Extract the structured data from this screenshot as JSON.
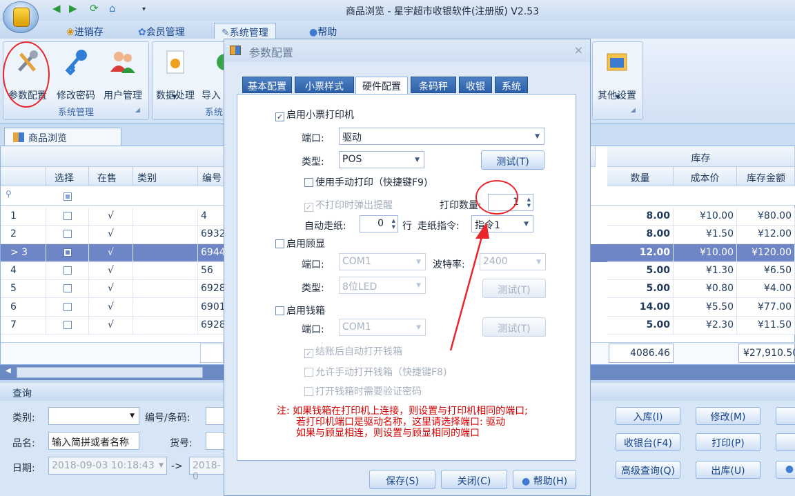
{
  "window": {
    "title": "商品浏览 - 星宇超市收银软件(注册版) V2.53",
    "quick_access": [
      "◀",
      "▶",
      "⟳",
      "⌂",
      "▾"
    ]
  },
  "ribbon_tabs": [
    "进销存",
    "会员管理",
    "系统管理",
    "帮助"
  ],
  "ribbon": {
    "group1": {
      "label": "系统管理",
      "buttons": [
        "参数配置",
        "修改密码",
        "用户管理"
      ]
    },
    "group2": {
      "label": "系统",
      "buttons": [
        "数据处理",
        "导入"
      ]
    },
    "group3": {
      "label": "",
      "buttons": [
        "其他设置"
      ]
    }
  },
  "doc_tab": "商品浏览",
  "grid": {
    "headers": {
      "select": "选择",
      "on_sale": "在售",
      "category": "类别",
      "code": "编号",
      "stock_group": "库存",
      "qty": "数量",
      "cost": "成本价",
      "amount": "库存金额"
    },
    "rows": [
      {
        "no": "1",
        "code": "4",
        "qty": "8.00",
        "cost": "¥10.00",
        "amount": "¥80.00",
        "mark": "√"
      },
      {
        "no": "2",
        "code": "6932",
        "qty": "8.00",
        "cost": "¥1.50",
        "amount": "¥12.00",
        "mark": "√"
      },
      {
        "no": "3",
        "code": "6944",
        "qty": "12.00",
        "cost": "¥10.00",
        "amount": "¥120.00",
        "mark": "√",
        "current": ">"
      },
      {
        "no": "4",
        "code": "56",
        "qty": "5.00",
        "cost": "¥1.30",
        "amount": "¥6.50",
        "mark": "√"
      },
      {
        "no": "5",
        "code": "6928",
        "qty": "5.00",
        "cost": "¥0.80",
        "amount": "¥4.00",
        "mark": "√"
      },
      {
        "no": "6",
        "code": "6901",
        "qty": "14.00",
        "cost": "¥5.50",
        "amount": "¥77.00",
        "mark": "√"
      },
      {
        "no": "7",
        "code": "6928",
        "qty": "5.00",
        "cost": "¥2.30",
        "amount": "¥11.50",
        "mark": "√"
      }
    ],
    "totals": {
      "qty": "4086.46",
      "amount": "¥27,910.50"
    }
  },
  "query": {
    "title": "查询",
    "category_label": "类别:",
    "code_label": "编号/条码:",
    "name_label": "品名:",
    "name_placeholder": "输入简拼或者名称",
    "item_no_label": "货号:",
    "date_label": "日期:",
    "date_from": "2018-09-03 10:18:43",
    "date_to": "2018-0",
    "arrow": "->",
    "buttons": [
      "入库(I)",
      "修改(M)",
      "收银台(F4)",
      "打印(P)",
      "高级查询(Q)",
      "出库(U)"
    ]
  },
  "dialog": {
    "title": "参数配置",
    "close": "×",
    "tabs": [
      "基本配置",
      "小票样式",
      "硬件配置",
      "条码秤",
      "收银",
      "系统"
    ],
    "printer": {
      "enable_label": "启用小票打印机",
      "port_label": "端口:",
      "port_value": "驱动",
      "type_label": "类型:",
      "type_value": "POS",
      "test_button": "测试(T)",
      "manual_label": "使用手动打印（快捷键F9)",
      "no_print_remind_label": "不打印时弹出提醒",
      "copies_label": "打印数量:",
      "copies_value": "1",
      "feed_label": "自动走纸:",
      "feed_value": "0",
      "feed_unit": "行",
      "cmd_label": "走纸指令:",
      "cmd_value": "指令1"
    },
    "display": {
      "enable_label": "启用顾显",
      "port_label": "端口:",
      "port_value": "COM1",
      "baud_label": "波特率:",
      "baud_value": "2400",
      "type_label": "类型:",
      "type_value": "8位LED",
      "test_button": "测试(T)"
    },
    "cashbox": {
      "enable_label": "启用钱箱",
      "port_label": "端口:",
      "port_value": "COM1",
      "test_button": "测试(T)",
      "auto_open_label": "结账后自动打开钱箱",
      "manual_open_label": "允许手动打开钱箱（快捷键F8)",
      "password_label": "打开钱箱时需要验证密码"
    },
    "note_lines": [
      "注: 如果钱箱在打印机上连接，则设置与打印机相同的端口;",
      "若打印机端口是驱动名称，这里请选择端口: 驱动",
      "如果与顾显相连，则设置与顾显相同的端口"
    ],
    "buttons": {
      "save": "保存(S)",
      "close": "关闭(C)",
      "help": "帮助(H)"
    }
  },
  "colors": {
    "annotation": "#e8262b",
    "selected_row": "#6f86c6",
    "note_text": "#d40000"
  }
}
